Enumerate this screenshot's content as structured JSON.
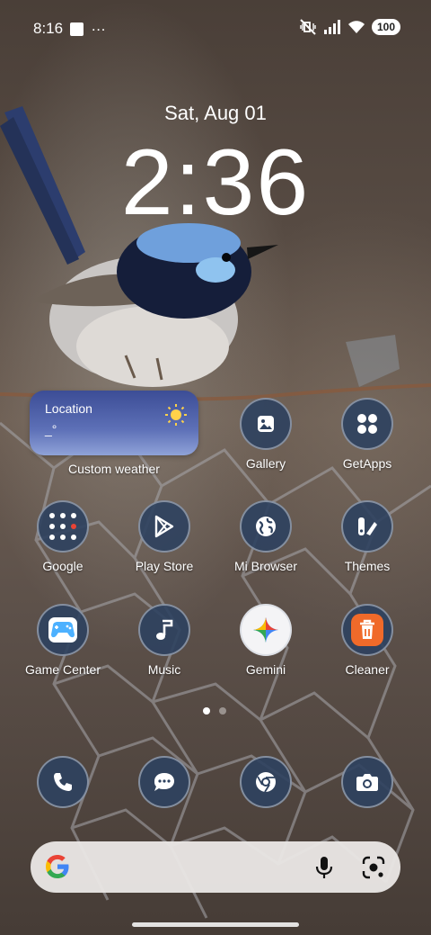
{
  "status_bar": {
    "time": "8:16",
    "battery": "100",
    "icons": [
      "square-notification-icon",
      "more-dots-icon",
      "mute-vibrate-icon",
      "signal-icon",
      "wifi-icon",
      "battery-icon"
    ]
  },
  "lock": {
    "date": "Sat, Aug 01",
    "time": "2:36"
  },
  "weather_widget": {
    "location": "Location",
    "temp": "_°",
    "label": "Custom weather",
    "icon": "sun-icon"
  },
  "apps": [
    {
      "label": "Gallery",
      "icon": "gallery-icon"
    },
    {
      "label": "GetApps",
      "icon": "getapps-icon"
    },
    {
      "label": "Google",
      "icon": "google-folder-icon"
    },
    {
      "label": "Play Store",
      "icon": "play-store-icon"
    },
    {
      "label": "Mi Browser",
      "icon": "globe-icon"
    },
    {
      "label": "Themes",
      "icon": "themes-icon"
    },
    {
      "label": "Game Center",
      "icon": "gamepad-icon"
    },
    {
      "label": "Music",
      "icon": "music-note-icon"
    },
    {
      "label": "Gemini",
      "icon": "gemini-icon"
    },
    {
      "label": "Cleaner",
      "icon": "trash-icon"
    }
  ],
  "dock": [
    {
      "icon": "phone-icon"
    },
    {
      "icon": "messages-icon"
    },
    {
      "icon": "chrome-icon"
    },
    {
      "icon": "camera-icon"
    }
  ],
  "page_indicator": {
    "pages": 2,
    "current": 1
  },
  "search_bar": {
    "logo": "google-g-icon",
    "icons": [
      "mic-icon",
      "lens-icon"
    ]
  },
  "colors": {
    "icon_bg": "#2d415f",
    "cleaner": "#f06a2a",
    "weather_top": "#3c4d96"
  }
}
